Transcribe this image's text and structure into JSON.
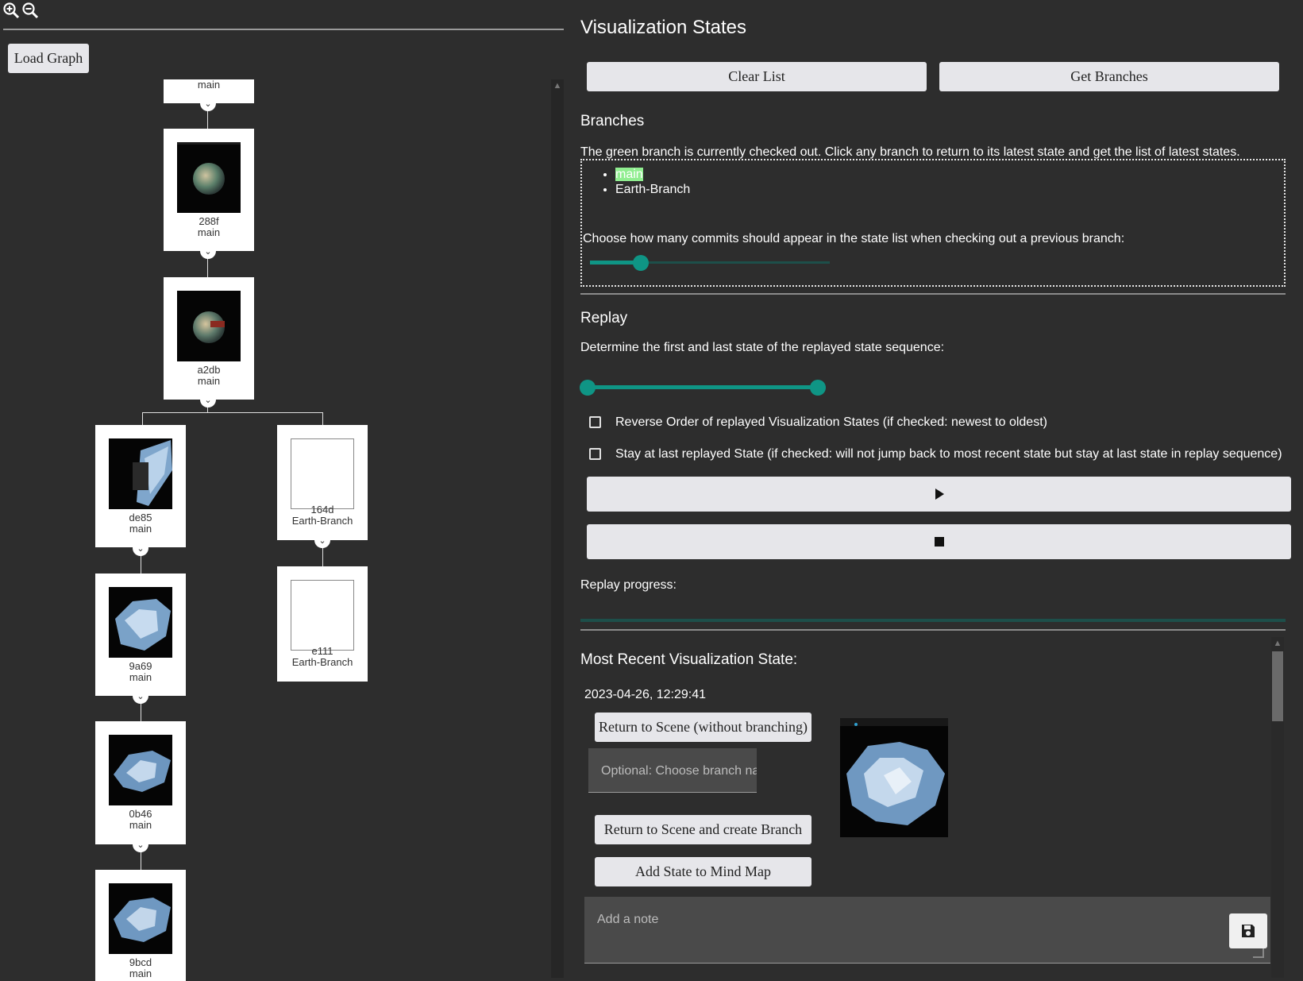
{
  "toolbar": {
    "zoom_in_icon": "zoom-in-icon",
    "zoom_out_icon": "zoom-out-icon",
    "load_graph_label": "Load Graph"
  },
  "graph": {
    "nodes": [
      {
        "id": "",
        "branch": "main"
      },
      {
        "id": "288f",
        "branch": "main"
      },
      {
        "id": "a2db",
        "branch": "main"
      },
      {
        "id": "de85",
        "branch": "main"
      },
      {
        "id": "164d",
        "branch": "Earth-Branch"
      },
      {
        "id": "9a69",
        "branch": "main"
      },
      {
        "id": "e111",
        "branch": "Earth-Branch"
      },
      {
        "id": "0b46",
        "branch": "main"
      },
      {
        "id": "9bcd",
        "branch": "main"
      }
    ]
  },
  "panel": {
    "title": "Visualization States",
    "clear_list_label": "Clear List",
    "get_branches_label": "Get Branches"
  },
  "branches": {
    "heading": "Branches",
    "description": "The green branch is currently checked out. Click any branch to return to its latest state and get the list of latest states.",
    "items": [
      "main",
      "Earth-Branch"
    ],
    "active_color": "#90ee90",
    "commits_label": "Choose how many commits should appear in the state list when checking out a previous branch:",
    "commits_slider_fraction": 0.19
  },
  "replay": {
    "heading": "Replay",
    "range_label": "Determine the first and last state of the replayed state sequence:",
    "range_start_fraction": 0.0,
    "range_end_fraction": 1.0,
    "reverse_label": "Reverse Order of replayed Visualization States (if checked: newest to oldest)",
    "stay_label": "Stay at last replayed State (if checked: will not jump back to most recent state but stay at last state in replay sequence)",
    "play_icon": "play-icon",
    "stop_icon": "stop-icon",
    "progress_label": "Replay progress:",
    "progress_fraction": 0.0
  },
  "recent": {
    "heading": "Most Recent Visualization State:",
    "timestamp": "2023-04-26, 12:29:41",
    "return_label": "Return to Scene (without branching)",
    "branch_name_placeholder": "Optional: Choose branch name",
    "return_branch_label": "Return to Scene and create Branch",
    "mindmap_label": "Add State to Mind Map",
    "note_placeholder": "Add a note",
    "save_icon": "save-icon"
  },
  "colors": {
    "background": "#2d2d2d",
    "accent": "#0f9585",
    "button": "#e6e6ea"
  }
}
